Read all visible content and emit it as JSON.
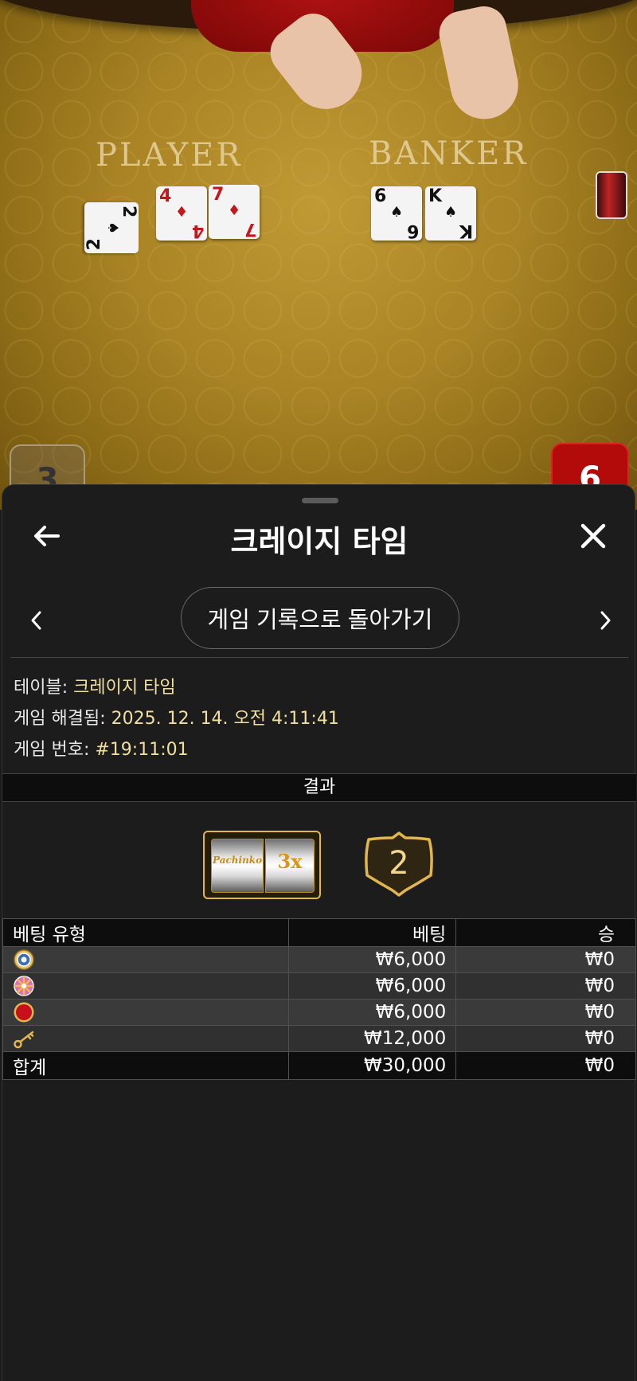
{
  "video": {
    "player_label": "PLAYER",
    "banker_label": "BANKER",
    "player_cards": [
      {
        "rank": "2",
        "suit": "♠",
        "color": "black"
      },
      {
        "rank": "4",
        "suit": "♦",
        "color": "red"
      },
      {
        "rank": "7",
        "suit": "♦",
        "color": "red"
      }
    ],
    "banker_cards": [
      {
        "rank": "6",
        "suit": "♠",
        "color": "black"
      },
      {
        "rank": "K",
        "suit": "♠",
        "color": "black"
      }
    ],
    "player_score": "3",
    "banker_score": "6"
  },
  "header": {
    "title": "크레이지 타임",
    "back_icon": "arrow-left-icon",
    "close_icon": "close-icon"
  },
  "nav": {
    "return_label": "게임 기록으로 돌아가기"
  },
  "info": {
    "table_label": "테이블:",
    "table_value": "크레이지 타임",
    "resolved_label": "게임 해결됨:",
    "resolved_value": "2025. 12. 14. 오전 4:11:41",
    "game_no_label": "게임 번호:",
    "game_no_value": "#19:11:01"
  },
  "result": {
    "header": "결과",
    "slot_left": "Pachinko",
    "slot_right": "3x",
    "segment": "2",
    "accent_color": "#e3b64b"
  },
  "bets": {
    "columns": [
      "베팅 유형",
      "베팅",
      "승"
    ],
    "rows": [
      {
        "icon": "coin-flip-icon",
        "bet": "₩6,000",
        "win": "₩0"
      },
      {
        "icon": "pachinko-icon",
        "bet": "₩6,000",
        "win": "₩0"
      },
      {
        "icon": "cash-hunt-icon",
        "bet": "₩6,000",
        "win": "₩0"
      },
      {
        "icon": "key-icon",
        "bet": "₩12,000",
        "win": "₩0"
      }
    ],
    "total_label": "합계",
    "total_bet": "₩30,000",
    "total_win": "₩0"
  }
}
